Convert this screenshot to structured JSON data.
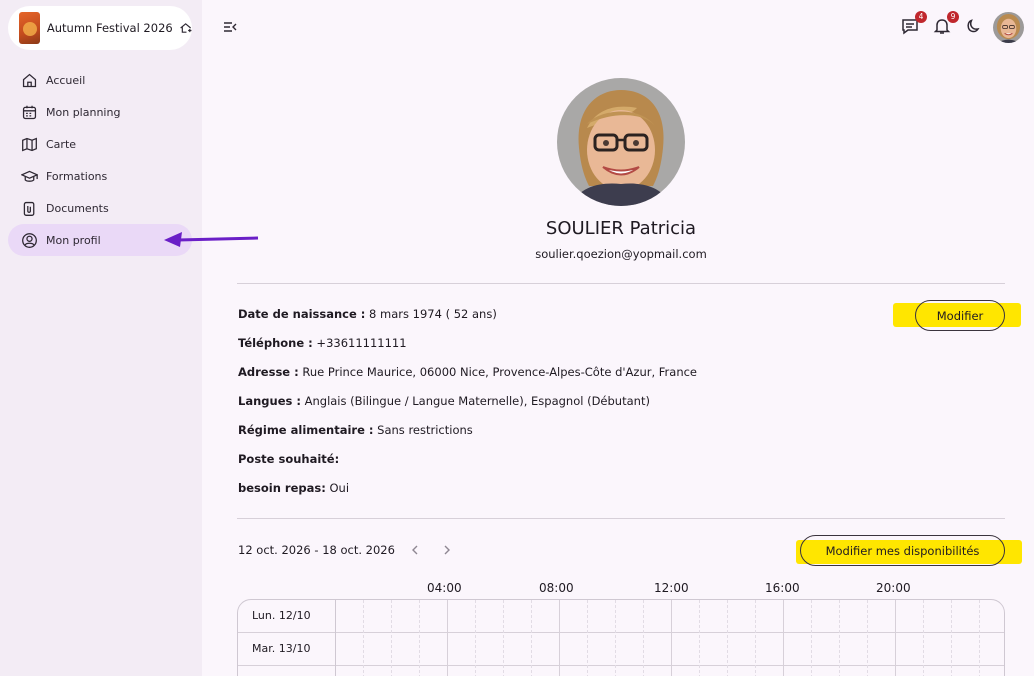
{
  "app": {
    "festival_name": "Autumn Festival 2026"
  },
  "sidebar": {
    "items": [
      {
        "label": "Accueil",
        "icon": "home-icon",
        "active": false
      },
      {
        "label": "Mon planning",
        "icon": "calendar-icon",
        "active": false
      },
      {
        "label": "Carte",
        "icon": "map-icon",
        "active": false
      },
      {
        "label": "Formations",
        "icon": "graduation-cap-icon",
        "active": false
      },
      {
        "label": "Documents",
        "icon": "paperclip-icon",
        "active": false
      },
      {
        "label": "Mon profil",
        "icon": "user-circle-icon",
        "active": true
      }
    ]
  },
  "topbar": {
    "messages_count": "4",
    "notifications_count": "9"
  },
  "profile": {
    "name": "SOULIER Patricia",
    "email": "soulier.qoezion@yopmail.com",
    "edit_label": "Modifier",
    "fields": [
      {
        "label": "Date de naissance :",
        "value": " 8 mars 1974 ( 52 ans)"
      },
      {
        "label": "Téléphone :",
        "value": " +33611111111"
      },
      {
        "label": "Adresse :",
        "value": " Rue Prince Maurice, 06000 Nice, Provence-Alpes-Côte d'Azur, France"
      },
      {
        "label": "Langues :",
        "value": " Anglais (Bilingue / Langue Maternelle), Espagnol (Débutant)"
      },
      {
        "label": "Régime alimentaire :",
        "value": " Sans restrictions"
      },
      {
        "label": "Poste souhaité:",
        "value": ""
      },
      {
        "label": "besoin repas:",
        "value": " Oui"
      }
    ]
  },
  "availability": {
    "week_range": "12 oct. 2026 - 18 oct. 2026",
    "edit_label": "Modifier mes disponibilités",
    "hours": [
      "04:00",
      "08:00",
      "12:00",
      "16:00",
      "20:00"
    ],
    "days": [
      "Lun. 12/10",
      "Mar. 13/10"
    ]
  },
  "colors": {
    "accent": "#6a1fc7",
    "highlight": "#ffe600",
    "active_nav": "#ead9f7",
    "badge": "#c0272d"
  }
}
